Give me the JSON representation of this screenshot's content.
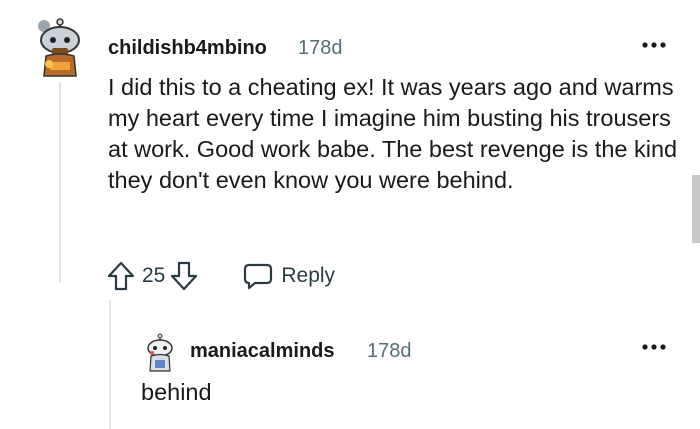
{
  "comment": {
    "author": "childishb4mbino",
    "age": "178d",
    "body": "I did this to a cheating ex! It was years ago and warms my heart every time I imagine him busting his trousers at work. Good work babe. The best revenge is the kind they don't even know you were behind.",
    "score": "25",
    "reply_label": "Reply",
    "more_icon": "more-dots-icon",
    "avatar_icon": "snoo-avatar-icon"
  },
  "reply": {
    "author": "maniacalminds",
    "age": "178d",
    "body": "behind",
    "more_icon": "more-dots-icon",
    "avatar_icon": "snoo-avatar-icon"
  },
  "colors": {
    "text": "#1a1a1b",
    "meta": "#576f76",
    "action": "#2a3c42",
    "thread_line": "#e4e4e4"
  }
}
